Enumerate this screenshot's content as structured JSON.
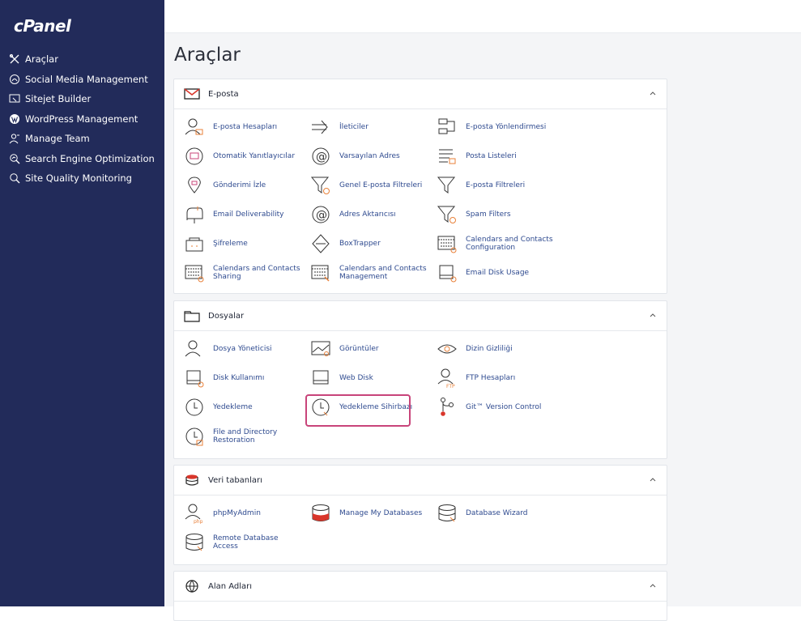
{
  "app": {
    "logo": "cPanel"
  },
  "sidebar": {
    "items": [
      {
        "label": "Araçlar",
        "icon": "tools-icon"
      },
      {
        "label": "Social Media Management",
        "icon": "social-icon"
      },
      {
        "label": "Sitejet Builder",
        "icon": "builder-icon"
      },
      {
        "label": "WordPress Management",
        "icon": "wordpress-icon"
      },
      {
        "label": "Manage Team",
        "icon": "team-icon"
      },
      {
        "label": "Search Engine Optimization",
        "icon": "seo-icon"
      },
      {
        "label": "Site Quality Monitoring",
        "icon": "monitor-icon"
      }
    ]
  },
  "main": {
    "title": "Araçlar",
    "panels": [
      {
        "title": "E-posta",
        "icon": "mail-icon",
        "tools": [
          "E-posta Hesapları",
          "İleticiler",
          "E-posta Yönlendirmesi",
          "Otomatik Yanıtlayıcılar",
          "Varsayılan Adres",
          "Posta Listeleri",
          "Gönderimi İzle",
          "Genel E-posta Filtreleri",
          "E-posta Filtreleri",
          "Email Deliverability",
          "Adres Aktarıcısı",
          "Spam Filters",
          "Şifreleme",
          "BoxTrapper",
          "Calendars and Contacts Configuration",
          "Calendars and Contacts Sharing",
          "Calendars and Contacts Management",
          "Email Disk Usage"
        ]
      },
      {
        "title": "Dosyalar",
        "icon": "folder-icon",
        "tools": [
          "Dosya Yöneticisi",
          "Görüntüler",
          "Dizin Gizliliği",
          "Disk Kullanımı",
          "Web Disk",
          "FTP Hesapları",
          "Yedekleme",
          "Yedekleme Sihirbazı",
          "Git™ Version Control",
          "File and Directory Restoration"
        ]
      },
      {
        "title": "Veri tabanları",
        "icon": "database-icon",
        "tools": [
          "phpMyAdmin",
          "Manage My Databases",
          "Database Wizard",
          "Remote Database Access"
        ]
      },
      {
        "title": "Alan Adları",
        "icon": "globe-icon",
        "tools": []
      }
    ]
  },
  "colors": {
    "sidebar": "#222b5a",
    "link": "#2e4a8f",
    "highlight": "#c8447a"
  }
}
